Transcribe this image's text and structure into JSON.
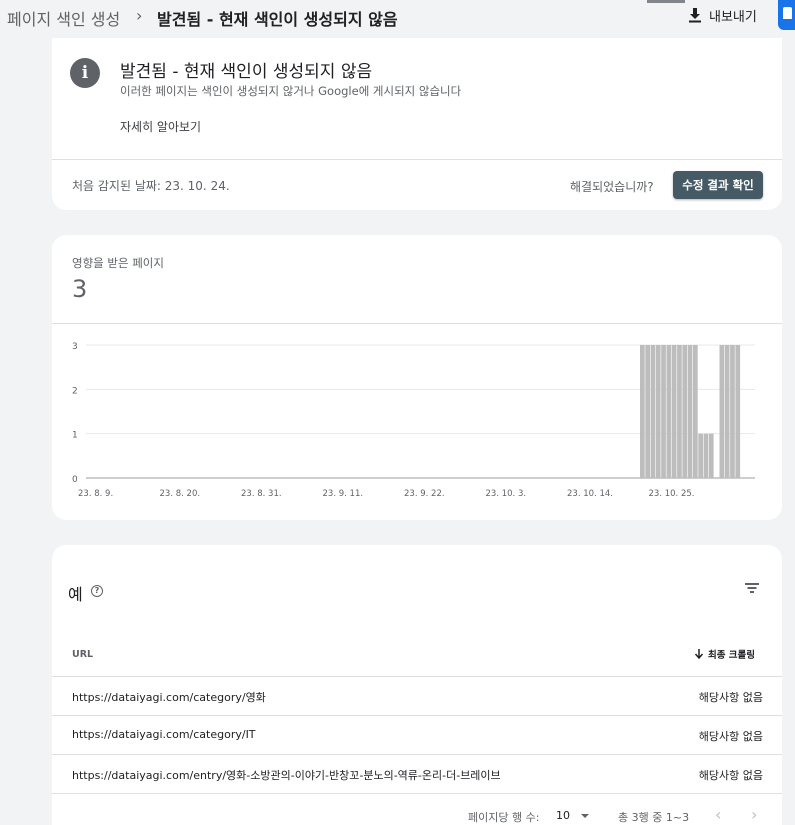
{
  "breadcrumb": {
    "root": "페이지 색인 생성",
    "separator": "›",
    "current": "발견됨 - 현재 색인이 생성되지 않음"
  },
  "toolbar": {
    "export_label": "내보내기",
    "export_icon": "download-icon"
  },
  "issue": {
    "icon": "info-icon",
    "title": "발견됨 - 현재 색인이 생성되지 않음",
    "description": "이러한 페이지는 색인이 생성되지 않거나 Google에 게시되지 않습니다",
    "learn_more": "자세히 알아보기",
    "first_detected": "처음 감지된 날짜: 23. 10. 24.",
    "resolved_question": "해결되었습니까?",
    "validate_button": "수정 결과 확인"
  },
  "affected": {
    "label": "영향을 받은 페이지",
    "count": "3"
  },
  "chart_data": {
    "type": "bar",
    "title": "",
    "xlabel": "",
    "ylabel": "",
    "ylim": [
      0,
      3
    ],
    "yticks": [
      0,
      1,
      2,
      3
    ],
    "x_tick_labels": [
      "23. 8. 9.",
      "23. 8. 20.",
      "23. 8. 31.",
      "23. 9. 11.",
      "23. 9. 22.",
      "23. 10. 3.",
      "23. 10. 14.",
      "23. 10. 25."
    ],
    "categories": [
      "23.10.24",
      "23.10.25",
      "23.10.26",
      "23.10.27",
      "23.10.28",
      "23.10.29",
      "23.10.30",
      "23.10.31",
      "23.11.1",
      "23.11.2",
      "23.11.3",
      "23.11.4",
      "23.11.5",
      "23.11.6",
      "23.11.7",
      "23.11.8",
      "23.11.9",
      "23.11.10",
      "23.11.11"
    ],
    "values": [
      3,
      3,
      3,
      3,
      3,
      3,
      3,
      3,
      3,
      3,
      3,
      1,
      1,
      1,
      0,
      3,
      3,
      3,
      3
    ],
    "bar_color": "#bdbdbd",
    "grid": true
  },
  "examples": {
    "title": "예",
    "help_icon": "help-icon",
    "filter_icon": "filter-icon",
    "columns": {
      "url": "URL",
      "last_crawl": "최종 크롤링"
    },
    "rows": [
      {
        "url": "https://dataiyagi.com/category/영화",
        "last_crawl": "해당사항 없음"
      },
      {
        "url": "https://dataiyagi.com/category/IT",
        "last_crawl": "해당사항 없음"
      },
      {
        "url": "https://dataiyagi.com/entry/영화-소방관의-이야기-반창꼬-분노의-역류-온리-더-브레이브",
        "last_crawl": "해당사항 없음"
      }
    ],
    "pagination": {
      "rows_per_page_label": "페이지당 행 수:",
      "rows_per_page": "10",
      "range": "총 3행 중 1~3",
      "prev": "‹",
      "next": "›"
    }
  },
  "colors": {
    "accent": "#1a73e8",
    "button_dark": "#455a64",
    "bar": "#bdbdbd"
  }
}
